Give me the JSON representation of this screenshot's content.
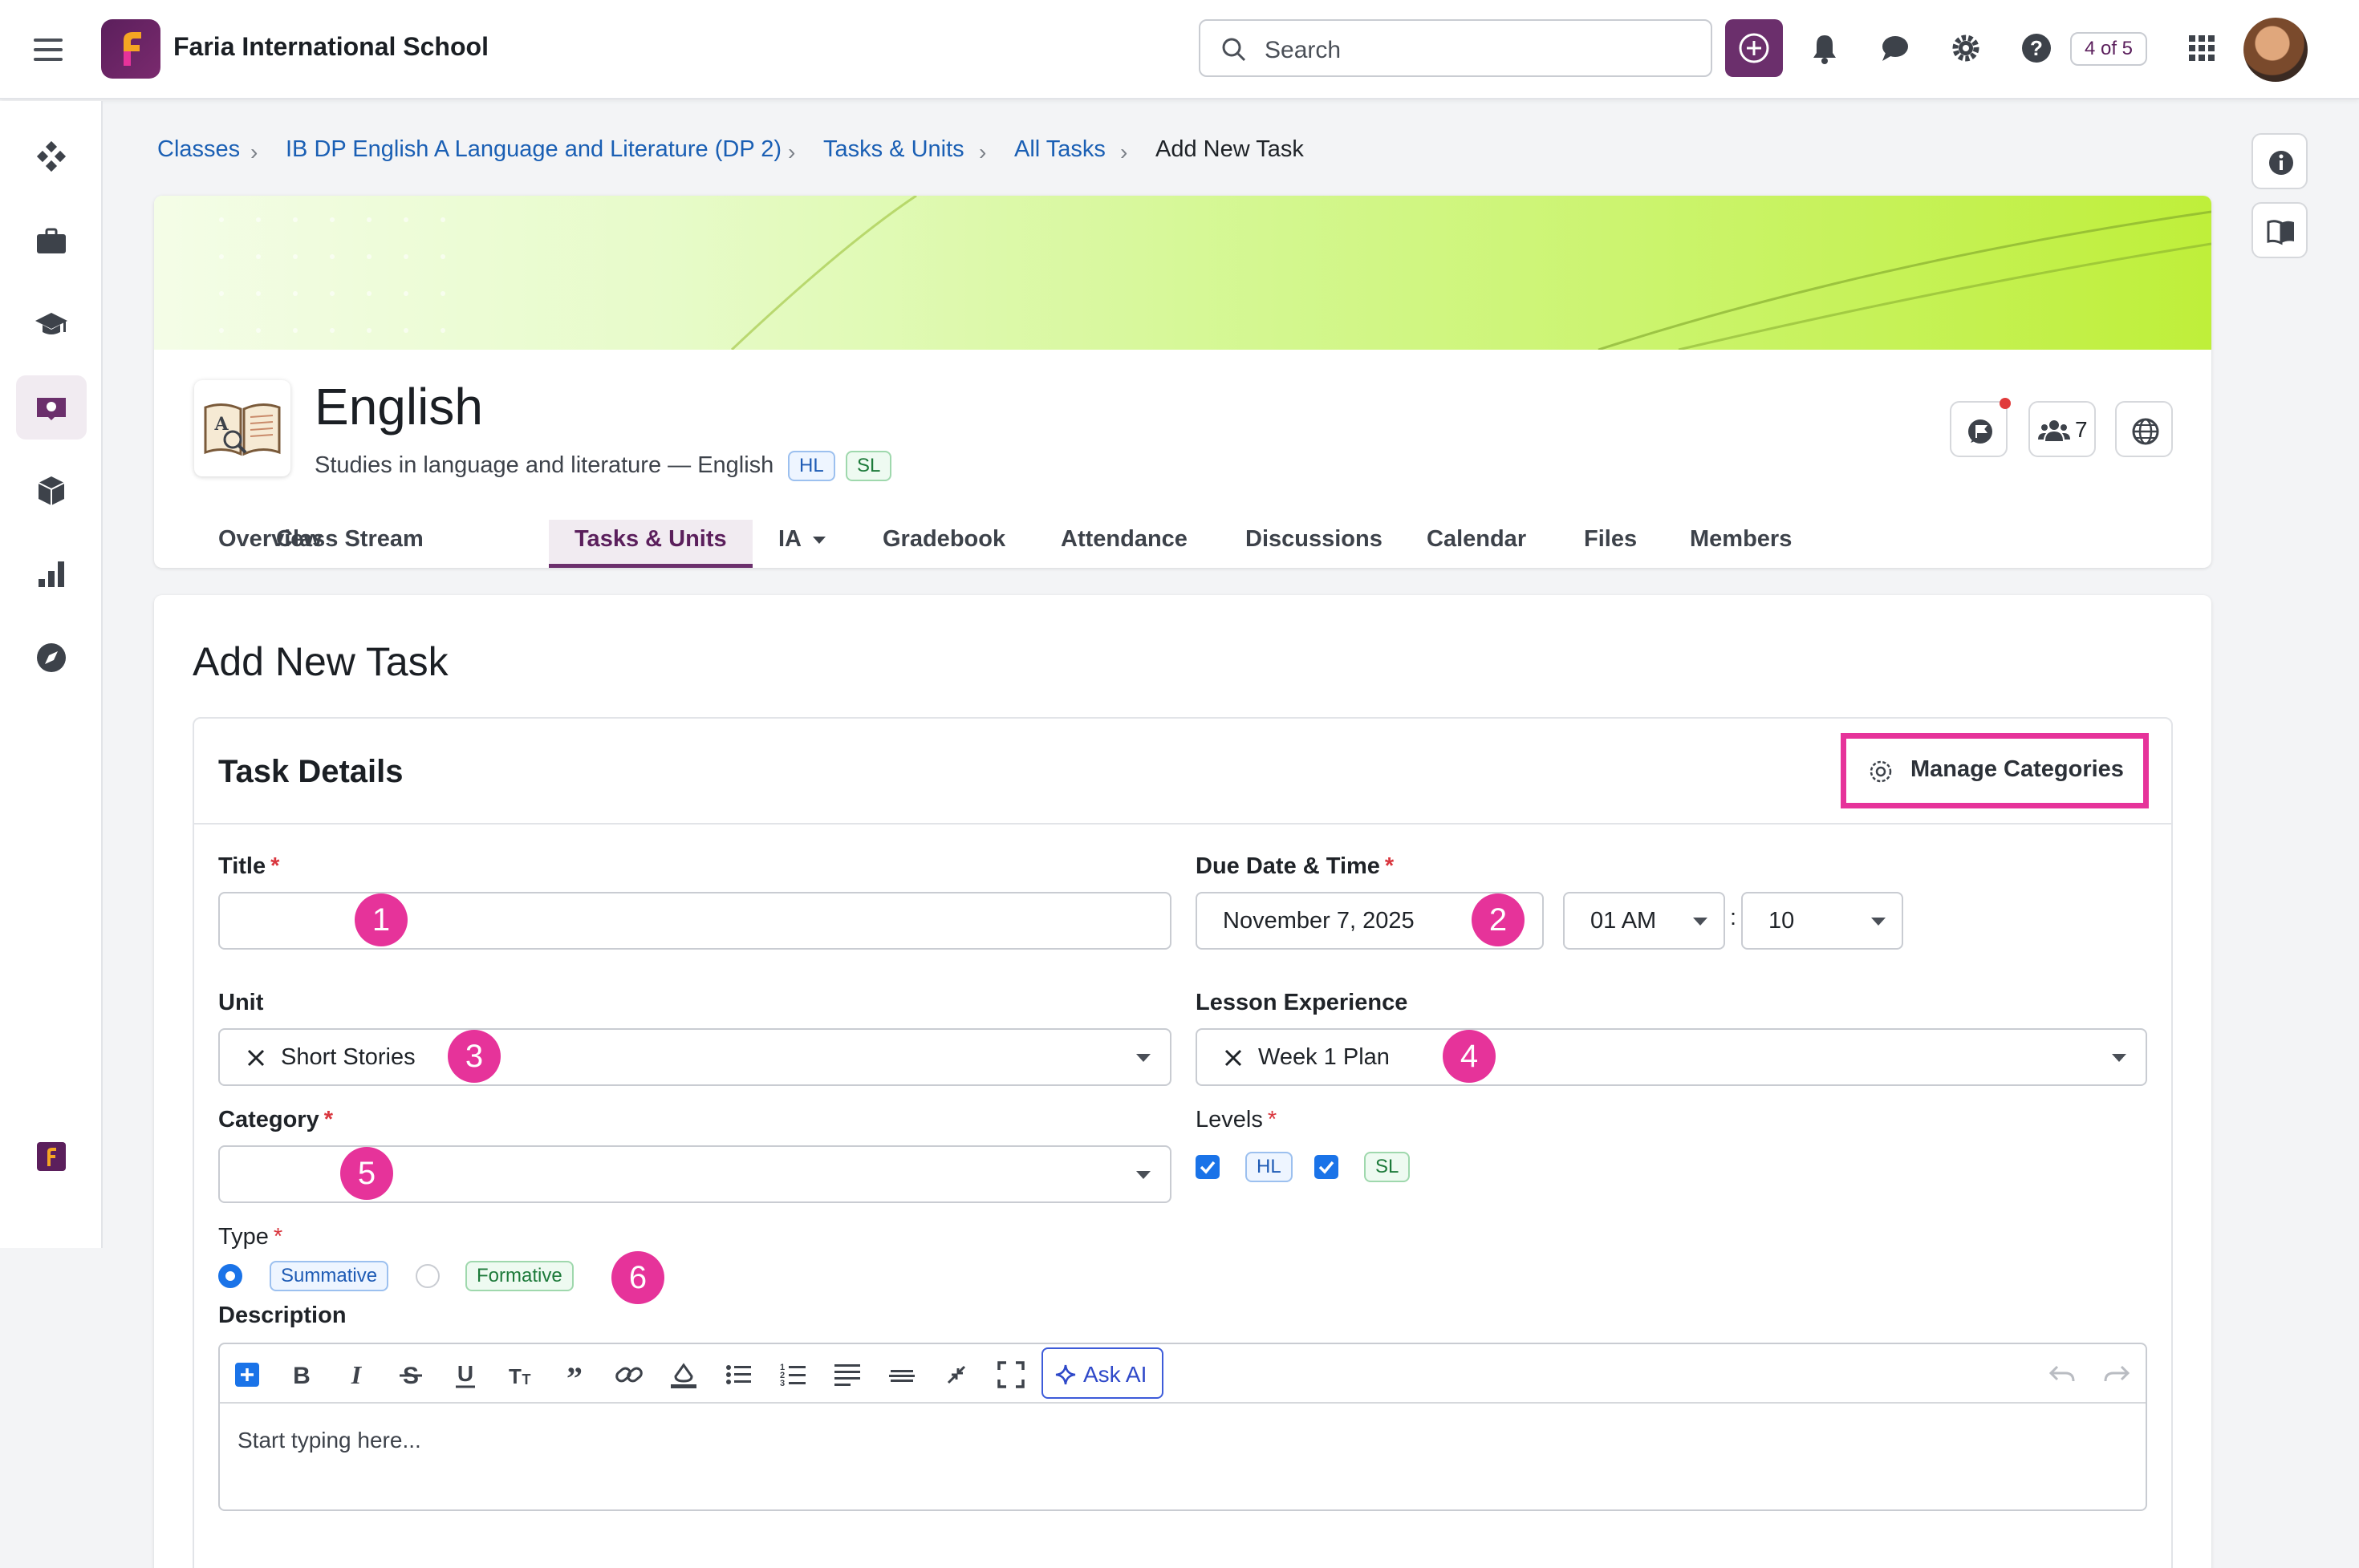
{
  "header": {
    "school_name": "Faria International School",
    "search_placeholder": "Search",
    "notification_counter": "4 of 5"
  },
  "breadcrumb": [
    {
      "label": "Classes"
    },
    {
      "label": "IB DP English A Language and Literature (DP 2)"
    },
    {
      "label": "Tasks & Units"
    },
    {
      "label": "All Tasks"
    },
    {
      "label": "Add New Task"
    }
  ],
  "class": {
    "title": "English",
    "subtitle": "Studies in language and literature — English",
    "tags": [
      "HL",
      "SL"
    ],
    "members_count": "7"
  },
  "tabs": [
    {
      "label": "Overview"
    },
    {
      "label": "Class Stream"
    },
    {
      "label": "Tasks & Units",
      "active": true
    },
    {
      "label": "IA"
    },
    {
      "label": "Gradebook"
    },
    {
      "label": "Attendance"
    },
    {
      "label": "Discussions"
    },
    {
      "label": "Calendar"
    },
    {
      "label": "Files"
    },
    {
      "label": "Members"
    }
  ],
  "form": {
    "page_title": "Add New Task",
    "section_title": "Task Details",
    "manage_categories": "Manage Categories",
    "title_label": "Title",
    "title_value": "",
    "due_label": "Due Date & Time",
    "due_date": "November 7, 2025",
    "due_hour": "01 AM",
    "time_sep": ":",
    "due_minute": "10",
    "unit_label": "Unit",
    "unit_value": "Short Stories",
    "lesson_label": "Lesson Experience",
    "lesson_value": "Week 1 Plan",
    "category_label": "Category",
    "category_value": "",
    "levels_label": "Levels",
    "levels": [
      {
        "label": "HL",
        "checked": true
      },
      {
        "label": "SL",
        "checked": true
      }
    ],
    "type_label": "Type",
    "types": [
      {
        "label": "Summative",
        "selected": true
      },
      {
        "label": "Formative",
        "selected": false
      }
    ],
    "description_label": "Description",
    "description_placeholder": "Start typing here...",
    "ask_ai": "Ask AI"
  },
  "annotations": [
    "1",
    "2",
    "3",
    "4",
    "5",
    "6"
  ],
  "colors": {
    "brand": "#5b1f5c",
    "highlight": "#e6339a",
    "link": "#1a5fb4",
    "banner": "#c4f03f"
  }
}
